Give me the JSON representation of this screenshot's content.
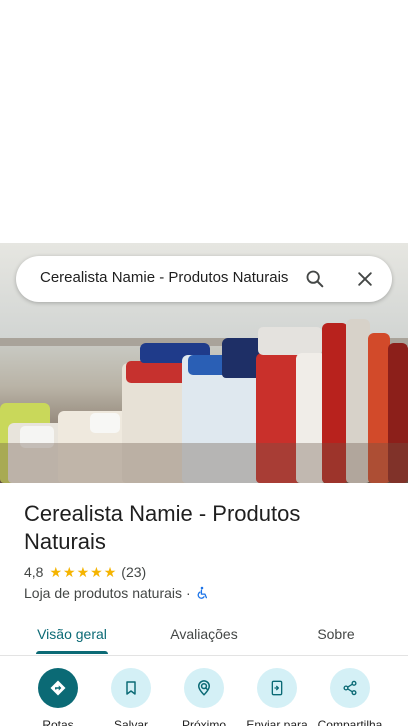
{
  "search": {
    "query": "Cerealista Namie - Produtos Naturais"
  },
  "place": {
    "name": "Cerealista Namie - Produtos Naturais",
    "rating": "4,8",
    "review_count": "(23)",
    "stars": 4.8,
    "category": "Loja de produtos naturais",
    "separator": "·"
  },
  "tabs": [
    {
      "label": "Visão geral",
      "active": true
    },
    {
      "label": "Avaliações",
      "active": false
    },
    {
      "label": "Sobre",
      "active": false
    }
  ],
  "actions": [
    {
      "label": "Rotas",
      "icon": "directions-icon"
    },
    {
      "label": "Salvar",
      "icon": "bookmark-icon"
    },
    {
      "label": "Próximo",
      "icon": "nearby-icon"
    },
    {
      "label": "Enviar para",
      "icon": "send-to-phone-icon"
    },
    {
      "label": "Compartilha",
      "icon": "share-icon"
    }
  ],
  "colors": {
    "accent": "#0b6a75",
    "action_bg": "#d4f0f6",
    "star": "#f5b400",
    "accessibility": "#1a73e8"
  }
}
